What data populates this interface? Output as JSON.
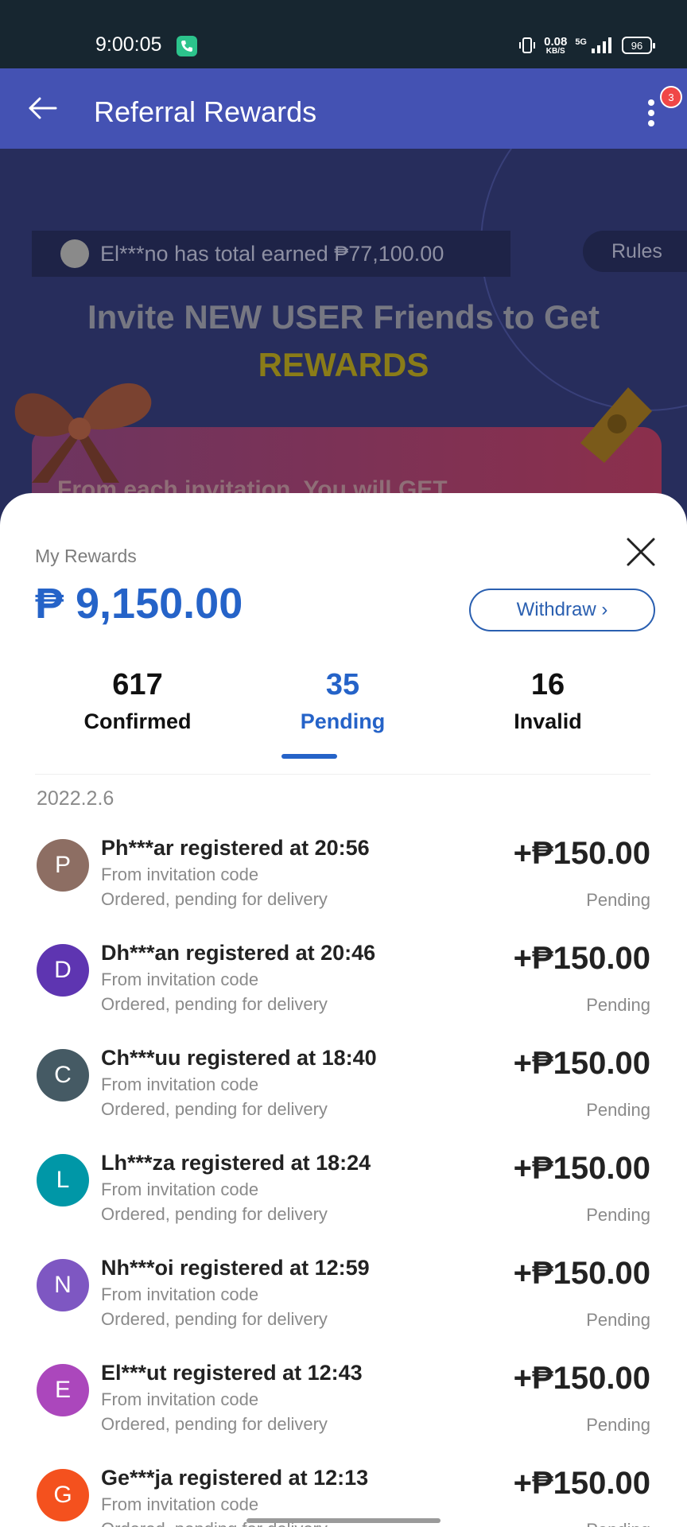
{
  "status_bar": {
    "time": "9:00:05",
    "speed_value": "0.08",
    "speed_unit": "KB/S",
    "network": "5G",
    "battery": "96"
  },
  "app_bar": {
    "title": "Referral Rewards",
    "badge_count": "3"
  },
  "banner": {
    "ticker_text": "El***no has total earned ₱77,100.00",
    "rules_label": "Rules",
    "title": "Invite NEW USER Friends to Get",
    "rewards_word": "REWARDS",
    "promo_text": "From each invitation, You will GET"
  },
  "sheet": {
    "rewards_label": "My Rewards",
    "rewards_amount": "₱ 9,150.00",
    "withdraw_label": "Withdraw ›",
    "tabs": [
      {
        "count": "617",
        "label": "Confirmed"
      },
      {
        "count": "35",
        "label": "Pending"
      },
      {
        "count": "16",
        "label": "Invalid"
      }
    ],
    "date": "2022.2.6",
    "items": [
      {
        "initial": "P",
        "color": "#8d6e63",
        "title": "Ph***ar registered at 20:56",
        "sub1": "From invitation code",
        "sub2": "Ordered, pending for delivery",
        "amount": "+₱150.00",
        "status": "Pending"
      },
      {
        "initial": "D",
        "color": "#5e35b1",
        "title": "Dh***an registered at 20:46",
        "sub1": "From invitation code",
        "sub2": "Ordered, pending for delivery",
        "amount": "+₱150.00",
        "status": "Pending"
      },
      {
        "initial": "C",
        "color": "#455a64",
        "title": "Ch***uu registered at 18:40",
        "sub1": "From invitation code",
        "sub2": "Ordered, pending for delivery",
        "amount": "+₱150.00",
        "status": "Pending"
      },
      {
        "initial": "L",
        "color": "#0097a7",
        "title": "Lh***za registered at 18:24",
        "sub1": "From invitation code",
        "sub2": "Ordered, pending for delivery",
        "amount": "+₱150.00",
        "status": "Pending"
      },
      {
        "initial": "N",
        "color": "#7e57c2",
        "title": "Nh***oi registered at 12:59",
        "sub1": "From invitation code",
        "sub2": "Ordered, pending for delivery",
        "amount": "+₱150.00",
        "status": "Pending"
      },
      {
        "initial": "E",
        "color": "#ab47bc",
        "title": "El***ut registered at 12:43",
        "sub1": "From invitation code",
        "sub2": "Ordered, pending for delivery",
        "amount": "+₱150.00",
        "status": "Pending"
      },
      {
        "initial": "G",
        "color": "#f4511e",
        "title": "Ge***ja registered at 12:13",
        "sub1": "From invitation code",
        "sub2": "Ordered, pending for delivery",
        "amount": "+₱150.00",
        "status": "Pending"
      }
    ]
  }
}
